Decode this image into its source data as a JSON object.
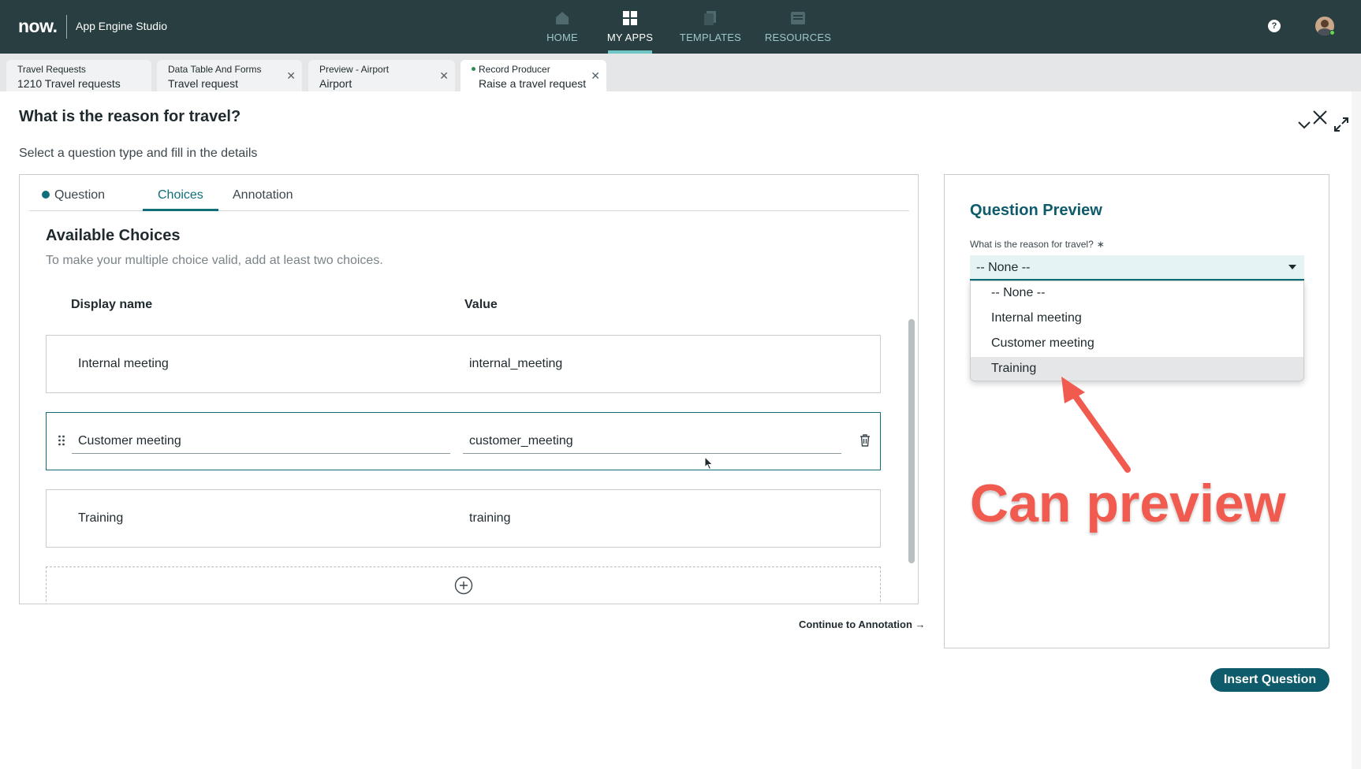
{
  "header": {
    "logo": "now.",
    "app_name": "App Engine Studio",
    "nav": [
      {
        "label": "HOME",
        "icon": "home-icon"
      },
      {
        "label": "MY APPS",
        "icon": "grid-icon"
      },
      {
        "label": "TEMPLATES",
        "icon": "templates-icon"
      },
      {
        "label": "RESOURCES",
        "icon": "resources-icon"
      }
    ],
    "help_glyph": "?",
    "colors": {
      "bar": "#293e40",
      "accent": "#6ec6c5"
    }
  },
  "file_tabs": [
    {
      "label": "Travel Requests",
      "sub": "1210 Travel requests"
    },
    {
      "label": "Data Table And Forms",
      "sub": "Travel request"
    },
    {
      "label": "Preview - Airport",
      "sub": "Airport"
    },
    {
      "label": "Record Producer",
      "sub": "Raise a travel request"
    }
  ],
  "dialog": {
    "title": "What is the reason for travel?",
    "subtitle": "Select a question type and fill in the details",
    "tabs": [
      "Question",
      "Choices",
      "Annotation"
    ],
    "available_title": "Available Choices",
    "available_hint": "To make your multiple choice valid, add at least two choices.",
    "col_display": "Display name",
    "col_value": "Value",
    "choices": [
      {
        "name": "Internal meeting",
        "value": "internal_meeting"
      },
      {
        "name": "Customer meeting",
        "value": "customer_meeting"
      },
      {
        "name": "Training",
        "value": "training"
      }
    ],
    "continue_label": "Continue to Annotation →"
  },
  "preview": {
    "title": "Question Preview",
    "label": "What is the reason for travel?",
    "required_mark": "∗",
    "selected": "-- None --",
    "options": [
      "-- None --",
      "Internal meeting",
      "Customer meeting",
      "Training"
    ]
  },
  "annotation": {
    "text": "Can preview",
    "color": "#f05a4f"
  },
  "insert_button": "Insert Question"
}
